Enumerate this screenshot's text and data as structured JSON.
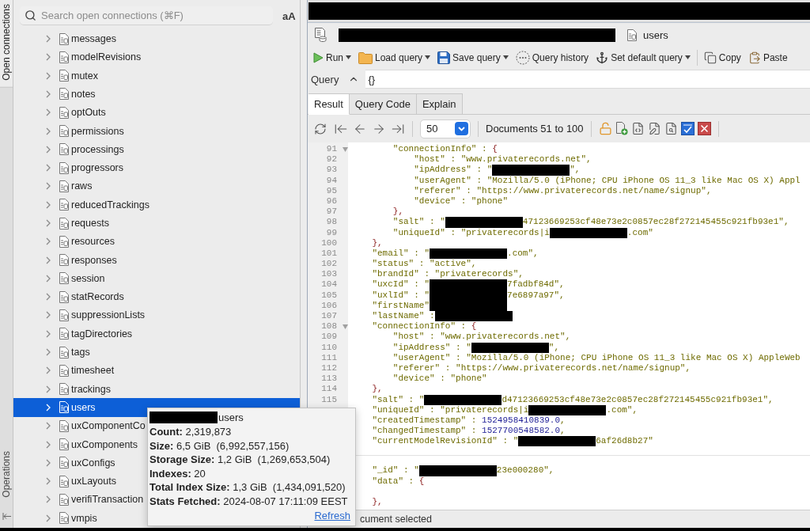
{
  "sidebar": {
    "tabs": [
      {
        "label": "Open connections",
        "selected": true
      },
      {
        "label": "Operations",
        "selected": false
      }
    ],
    "search": {
      "placeholder": "Search open connections (⌘F)",
      "case_toggle": "aA"
    },
    "collections": [
      {
        "name": "messages",
        "expanded": false,
        "selected": false
      },
      {
        "name": "modelRevisions",
        "expanded": false,
        "selected": false
      },
      {
        "name": "mutex",
        "expanded": false,
        "selected": false
      },
      {
        "name": "notes",
        "expanded": false,
        "selected": false
      },
      {
        "name": "optOuts",
        "expanded": false,
        "selected": false
      },
      {
        "name": "permissions",
        "expanded": false,
        "selected": false
      },
      {
        "name": "processings",
        "expanded": false,
        "selected": false
      },
      {
        "name": "progressors",
        "expanded": false,
        "selected": false
      },
      {
        "name": "raws",
        "expanded": false,
        "selected": false
      },
      {
        "name": "reducedTrackings",
        "expanded": false,
        "selected": false
      },
      {
        "name": "requests",
        "expanded": false,
        "selected": false
      },
      {
        "name": "resources",
        "expanded": false,
        "selected": false
      },
      {
        "name": "responses",
        "expanded": false,
        "selected": false
      },
      {
        "name": "session",
        "expanded": false,
        "selected": false
      },
      {
        "name": "statRecords",
        "expanded": false,
        "selected": false
      },
      {
        "name": "suppressionLists",
        "expanded": false,
        "selected": false
      },
      {
        "name": "tagDirectories",
        "expanded": false,
        "selected": false
      },
      {
        "name": "tags",
        "expanded": false,
        "selected": false
      },
      {
        "name": "timesheet",
        "expanded": false,
        "selected": false
      },
      {
        "name": "trackings",
        "expanded": false,
        "selected": false
      },
      {
        "name": "users",
        "expanded": false,
        "selected": true
      },
      {
        "name": "uxComponentCo",
        "expanded": false,
        "selected": false
      },
      {
        "name": "uxComponents",
        "expanded": false,
        "selected": false
      },
      {
        "name": "uxConfigs",
        "expanded": false,
        "selected": false
      },
      {
        "name": "uxLayouts",
        "expanded": false,
        "selected": false
      },
      {
        "name": "verifiTransaction",
        "expanded": false,
        "selected": false
      },
      {
        "name": "vmpis",
        "expanded": false,
        "selected": false
      }
    ]
  },
  "editor_tabs": {
    "redacted": true
  },
  "breadcrumb": {
    "path_redacted": true,
    "collection": "users"
  },
  "toolbar": {
    "query_buttons": [
      {
        "kind": "run",
        "label": "Run",
        "dropdown": true
      },
      {
        "kind": "load",
        "label": "Load query",
        "dropdown": true
      },
      {
        "kind": "save",
        "label": "Save query",
        "dropdown": true
      },
      {
        "kind": "history",
        "label": "Query history",
        "dropdown": false
      },
      {
        "kind": "set_default",
        "label": "Set default query",
        "dropdown": true
      }
    ],
    "clipboard_buttons": [
      {
        "kind": "copy",
        "label": "Copy",
        "dropdown": false
      },
      {
        "kind": "paste",
        "label": "Paste",
        "dropdown": false
      }
    ]
  },
  "query": {
    "label": "Query",
    "expanded": true,
    "value": "{}"
  },
  "result_tabs": [
    {
      "label": "Result",
      "selected": true
    },
    {
      "label": "Query Code",
      "selected": false
    },
    {
      "label": "Explain",
      "selected": false
    }
  ],
  "pager": {
    "page_size": "50",
    "range": "Documents 51 to 100"
  },
  "documents": [
    {
      "lines": [
        {
          "kind": "code",
          "number": "91",
          "fold": true,
          "tokens": [
            {
              "kind": "text",
              "text": "        \"connectionInfo\" : "
            },
            {
              "kind": "brace",
              "text": "{"
            }
          ]
        },
        {
          "kind": "code",
          "number": "92",
          "fold": false,
          "tokens": [
            {
              "kind": "text",
              "text": "            \"host\" : \"www.privaterecords.net\","
            }
          ]
        },
        {
          "kind": "code",
          "number": "93",
          "fold": false,
          "tokens": [
            {
              "kind": "text",
              "text": "            \"ipAddress\" : \""
            },
            {
              "kind": "redacted"
            },
            {
              "kind": "text",
              "text": "\","
            }
          ]
        },
        {
          "kind": "code",
          "number": "94",
          "fold": false,
          "tokens": [
            {
              "kind": "text",
              "text": "            \"userAgent\" : \"Mozilla/5.0 (iPhone; CPU iPhone OS 11_3 like Mac OS X) Appl"
            }
          ]
        },
        {
          "kind": "code",
          "number": "95",
          "fold": false,
          "tokens": [
            {
              "kind": "text",
              "text": "            \"referer\" : \"https://www.privaterecords.net/name/signup\","
            }
          ]
        },
        {
          "kind": "code",
          "number": "96",
          "fold": false,
          "tokens": [
            {
              "kind": "text",
              "text": "            \"device\" : \"phone\""
            }
          ]
        },
        {
          "kind": "code",
          "number": "97",
          "fold": false,
          "tokens": [
            {
              "kind": "brace",
              "text": "        },"
            }
          ]
        },
        {
          "kind": "code",
          "number": "98",
          "fold": false,
          "tokens": [
            {
              "kind": "text",
              "text": "        \"salt\" : \""
            },
            {
              "kind": "redacted"
            },
            {
              "kind": "text",
              "text": "47123669253cf48e73e2c0857ec28f272145455c921fb93e1\","
            }
          ]
        },
        {
          "kind": "code",
          "number": "99",
          "fold": false,
          "tokens": [
            {
              "kind": "text",
              "text": "        \"uniqueId\" : \"privaterecords|i"
            },
            {
              "kind": "redacted"
            },
            {
              "kind": "text",
              "text": ".com\""
            }
          ]
        },
        {
          "kind": "code",
          "number": "100",
          "fold": false,
          "tokens": [
            {
              "kind": "brace",
              "text": "    },"
            }
          ]
        },
        {
          "kind": "code",
          "number": "101",
          "fold": false,
          "tokens": [
            {
              "kind": "text",
              "text": "    \"email\" : \""
            },
            {
              "kind": "redacted"
            },
            {
              "kind": "text",
              "text": ".com\","
            }
          ]
        },
        {
          "kind": "code",
          "number": "102",
          "fold": false,
          "tokens": [
            {
              "kind": "text",
              "text": "    \"status\" : \"active\","
            }
          ]
        },
        {
          "kind": "code",
          "number": "103",
          "fold": false,
          "tokens": [
            {
              "kind": "text",
              "text": "    \"brandId\" : \"privaterecords\","
            }
          ]
        },
        {
          "kind": "code",
          "number": "104",
          "fold": false,
          "tokens": [
            {
              "kind": "text",
              "text": "    \"uxcId\" : \""
            },
            {
              "kind": "redacted"
            },
            {
              "kind": "text",
              "text": "7fadbf84d\","
            }
          ]
        },
        {
          "kind": "code",
          "number": "105",
          "fold": false,
          "tokens": [
            {
              "kind": "text",
              "text": "    \"uxlId\" : \""
            },
            {
              "kind": "redacted"
            },
            {
              "kind": "text",
              "text": "7e6897a97\","
            }
          ]
        },
        {
          "kind": "code",
          "number": "106",
          "fold": false,
          "tokens": [
            {
              "kind": "text",
              "text": "    \"firstName\""
            },
            {
              "kind": "redacted"
            }
          ]
        },
        {
          "kind": "code",
          "number": "107",
          "fold": false,
          "tokens": [
            {
              "kind": "text",
              "text": "    \"lastName\" :"
            },
            {
              "kind": "redacted"
            }
          ]
        },
        {
          "kind": "code",
          "number": "108",
          "fold": true,
          "tokens": [
            {
              "kind": "text",
              "text": "    \"connectionInfo\" : "
            },
            {
              "kind": "brace",
              "text": "{"
            }
          ]
        },
        {
          "kind": "code",
          "number": "109",
          "fold": false,
          "tokens": [
            {
              "kind": "text",
              "text": "        \"host\" : \"www.privaterecords.net\","
            }
          ]
        },
        {
          "kind": "code",
          "number": "110",
          "fold": false,
          "tokens": [
            {
              "kind": "text",
              "text": "        \"ipAddress\" : \""
            },
            {
              "kind": "redacted"
            },
            {
              "kind": "text",
              "text": "\","
            }
          ]
        },
        {
          "kind": "code",
          "number": "111",
          "fold": false,
          "tokens": [
            {
              "kind": "text",
              "text": "        \"userAgent\" : \"Mozilla/5.0 (iPhone; CPU iPhone OS 11_3 like Mac OS X) AppleWeb"
            }
          ]
        },
        {
          "kind": "code",
          "number": "112",
          "fold": false,
          "tokens": [
            {
              "kind": "text",
              "text": "        \"referer\" : \"https://www.privaterecords.net/name/signup\","
            }
          ]
        },
        {
          "kind": "code",
          "number": "113",
          "fold": false,
          "tokens": [
            {
              "kind": "text",
              "text": "        \"device\" : \"phone\""
            }
          ]
        },
        {
          "kind": "code",
          "number": "114",
          "fold": false,
          "tokens": [
            {
              "kind": "brace",
              "text": "    },"
            }
          ]
        },
        {
          "kind": "code",
          "number": "115",
          "fold": false,
          "tokens": [
            {
              "kind": "text",
              "text": "    \"salt\" : \""
            },
            {
              "kind": "redacted"
            },
            {
              "kind": "text",
              "text": "d47123669253cf48e73e2c0857ec28f272145455c921fb93e1\","
            }
          ]
        },
        {
          "kind": "code",
          "fold": false,
          "tokens": [
            {
              "kind": "text",
              "text": "    \"uniqueId\" : \"privaterecords|i"
            },
            {
              "kind": "redacted"
            },
            {
              "kind": "text",
              "text": ".com\","
            }
          ]
        },
        {
          "kind": "code",
          "fold": false,
          "tokens": [
            {
              "kind": "text",
              "text": "    \"createdTimestamp\" : "
            },
            {
              "kind": "number",
              "text": "1524958410839.0"
            },
            {
              "kind": "text",
              "text": ","
            }
          ]
        },
        {
          "kind": "code",
          "fold": false,
          "tokens": [
            {
              "kind": "text",
              "text": "    \"changedTimestamp\" : "
            },
            {
              "kind": "number",
              "text": "1527700548582.0"
            },
            {
              "kind": "text",
              "text": ","
            }
          ]
        },
        {
          "kind": "code",
          "fold": false,
          "tokens": [
            {
              "kind": "text",
              "text": "    \"currentModelRevisionId\" : \""
            },
            {
              "kind": "redacted"
            },
            {
              "kind": "text",
              "text": "6af26d8b27\""
            }
          ]
        }
      ]
    },
    {
      "lines": [
        {
          "kind": "code",
          "fold": false,
          "tokens": [
            {
              "kind": "text",
              "text": "    \"_id\" : \""
            },
            {
              "kind": "redacted"
            },
            {
              "kind": "text",
              "text": "23e000280\","
            }
          ]
        },
        {
          "kind": "code",
          "fold": false,
          "tokens": [
            {
              "kind": "text",
              "text": "    \"data\" : "
            },
            {
              "kind": "brace",
              "text": "{"
            }
          ]
        },
        {
          "kind": "blank"
        },
        {
          "kind": "code",
          "fold": false,
          "tokens": [
            {
              "kind": "brace",
              "text": "    },"
            }
          ]
        }
      ]
    }
  ],
  "status_bar": {
    "text": "cument selected"
  },
  "stats_popup": {
    "title_redacted": true,
    "title": "users",
    "lines": [
      "**Count:** 2,319,873",
      "**Size:** 6,5 GiB  (6,992,557,156)",
      "**Storage Size:** 1,2 GiB  (1,269,653,504)",
      "**Indexes:** 20",
      "**Total Index Size:** 1,3 GiB  (1,434,091,520)",
      "**Stats Fetched:** 2024-08-07 17:11:09 EEST"
    ],
    "link": "Refresh"
  }
}
